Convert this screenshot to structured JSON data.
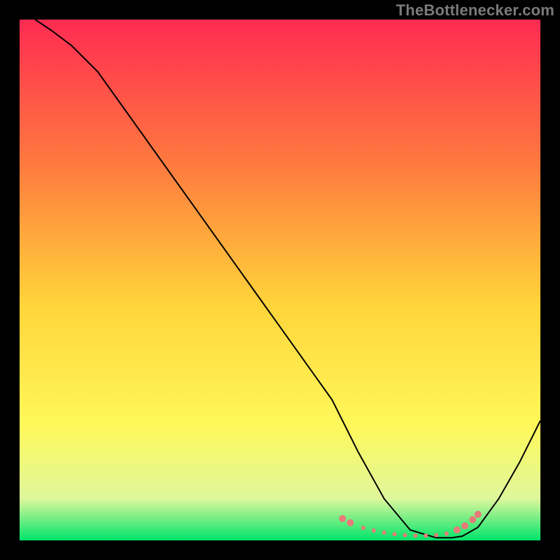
{
  "watermark": "TheBottlenecker.com",
  "chart_data": {
    "type": "line",
    "title": "",
    "xlabel": "",
    "ylabel": "",
    "xlim": [
      0,
      100
    ],
    "ylim": [
      0,
      100
    ],
    "grid": false,
    "legend": false,
    "background_gradient": {
      "top": "#ff2b52",
      "mid_upper": "#ff7b3f",
      "mid": "#ffd53a",
      "mid_lower": "#fff85a",
      "near_bottom": "#def79c",
      "bottom": "#00e46a"
    },
    "series": [
      {
        "name": "bottleneck-curve",
        "color": "#000000",
        "stroke_width": 2,
        "x": [
          3,
          6,
          10,
          15,
          20,
          25,
          30,
          35,
          40,
          45,
          50,
          55,
          60,
          62,
          65,
          70,
          75,
          80,
          83,
          85,
          88,
          92,
          96,
          100
        ],
        "y": [
          100,
          98,
          95,
          90,
          83,
          76,
          69,
          62,
          55,
          48,
          41,
          34,
          27,
          23,
          17,
          8,
          2,
          0.5,
          0.5,
          0.8,
          2.5,
          8,
          15,
          23
        ]
      }
    ],
    "markers": {
      "name": "highlighted-range",
      "color": "#e77b78",
      "radius_small": 3,
      "radius_large": 5,
      "points": [
        {
          "x": 62,
          "y": 4.2,
          "r": "large"
        },
        {
          "x": 63.5,
          "y": 3.4,
          "r": "large"
        },
        {
          "x": 66,
          "y": 2.4,
          "r": "small"
        },
        {
          "x": 68,
          "y": 1.9,
          "r": "small"
        },
        {
          "x": 70,
          "y": 1.5,
          "r": "small"
        },
        {
          "x": 72,
          "y": 1.2,
          "r": "small"
        },
        {
          "x": 74,
          "y": 1.0,
          "r": "small"
        },
        {
          "x": 76,
          "y": 0.9,
          "r": "small"
        },
        {
          "x": 78,
          "y": 0.9,
          "r": "small"
        },
        {
          "x": 80,
          "y": 1.0,
          "r": "small"
        },
        {
          "x": 82,
          "y": 1.3,
          "r": "small"
        },
        {
          "x": 84,
          "y": 2.0,
          "r": "large"
        },
        {
          "x": 85.5,
          "y": 2.8,
          "r": "large"
        },
        {
          "x": 87,
          "y": 4.0,
          "r": "large"
        },
        {
          "x": 88,
          "y": 5.0,
          "r": "large"
        }
      ]
    }
  }
}
